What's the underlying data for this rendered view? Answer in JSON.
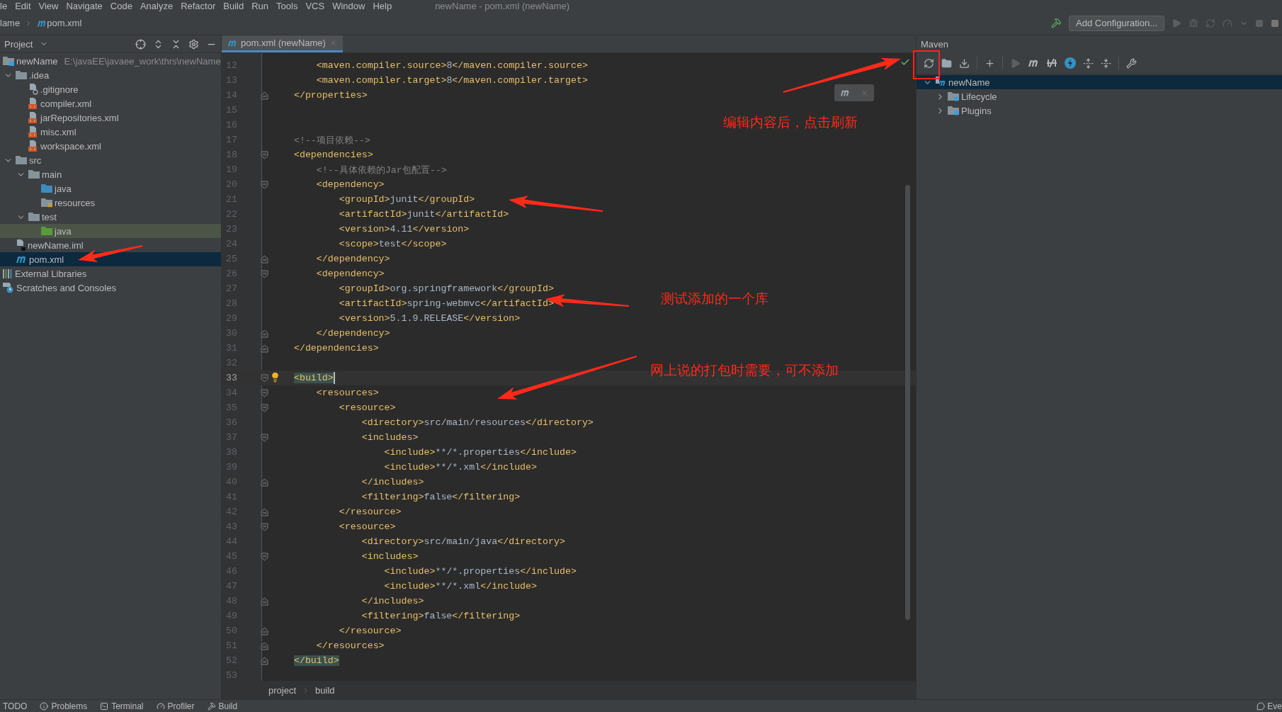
{
  "menu_bar": {
    "items": [
      "le",
      "Edit",
      "View",
      "Navigate",
      "Code",
      "Analyze",
      "Refactor",
      "Build",
      "Run",
      "Tools",
      "VCS",
      "Window",
      "Help"
    ],
    "title": "newName - pom.xml (newName)"
  },
  "nav_bar": {
    "breadcrumbs": [
      {
        "label": "lame",
        "kind": "plain"
      },
      {
        "label": "pom.xml",
        "kind": "maven"
      }
    ],
    "run_config": "Add Configuration..."
  },
  "project_panel": {
    "title": "Project",
    "tree": [
      {
        "label": "newName",
        "kind": "module",
        "path": "E:\\javaEE\\javaee_work\\thrs\\newName",
        "selected": false,
        "children": [
          {
            "label": ".idea",
            "kind": "folder",
            "expanded": true,
            "selected": false,
            "children": [
              {
                "label": ".gitignore",
                "kind": "ignore",
                "selected": false
              },
              {
                "label": "compiler.xml",
                "kind": "xml",
                "selected": false
              },
              {
                "label": "jarRepositories.xml",
                "kind": "xml",
                "selected": false
              },
              {
                "label": "misc.xml",
                "kind": "xml",
                "selected": false
              },
              {
                "label": "workspace.xml",
                "kind": "xml",
                "selected": false
              }
            ]
          },
          {
            "label": "src",
            "kind": "folder",
            "expanded": true,
            "selected": false,
            "children": [
              {
                "label": "main",
                "kind": "folder",
                "expanded": true,
                "selected": false,
                "children": [
                  {
                    "label": "java",
                    "kind": "source",
                    "selected": false
                  },
                  {
                    "label": "resources",
                    "kind": "resources",
                    "selected": false
                  }
                ]
              },
              {
                "label": "test",
                "kind": "folder",
                "expanded": true,
                "selected": false,
                "children": [
                  {
                    "label": "java",
                    "kind": "test",
                    "selected": false,
                    "highlighted": true
                  }
                ]
              }
            ]
          },
          {
            "label": "newName.iml",
            "kind": "iml",
            "selected": false
          },
          {
            "label": "pom.xml",
            "kind": "maven",
            "selected": true
          }
        ]
      },
      {
        "label": "External Libraries",
        "kind": "libraries",
        "selected": false
      },
      {
        "label": "Scratches and Consoles",
        "kind": "scratches",
        "selected": false
      }
    ]
  },
  "editor": {
    "tab": {
      "label": "pom.xml (newName)",
      "selected": true
    },
    "lines": [
      {
        "number": "12",
        "text": "        <maven.compiler.source>8</maven.compiler.source>"
      },
      {
        "number": "13",
        "text": "        <maven.compiler.target>8</maven.compiler.target>"
      },
      {
        "number": "14",
        "text": "    </properties>",
        "kind": "close"
      },
      {
        "number": "15"
      },
      {
        "number": "16"
      },
      {
        "number": "17",
        "text": "    <!--项目依赖-->"
      },
      {
        "number": "18",
        "text": "    <dependencies>",
        "kind": "open"
      },
      {
        "number": "19",
        "text": "        <!--具体依赖的Jar包配置-->"
      },
      {
        "number": "20",
        "text": "        <dependency>",
        "kind": "open"
      },
      {
        "number": "21",
        "text": "            <groupId>junit</groupId>"
      },
      {
        "number": "22",
        "text": "            <artifactId>junit</artifactId>"
      },
      {
        "number": "23",
        "text": "            <version>4.11</version>"
      },
      {
        "number": "24",
        "text": "            <scope>test</scope>"
      },
      {
        "number": "25",
        "text": "        </dependency>",
        "kind": "close"
      },
      {
        "number": "26",
        "text": "        <dependency>",
        "kind": "open"
      },
      {
        "number": "27",
        "text": "            <groupId>org.springframework</groupId>"
      },
      {
        "number": "28",
        "text": "            <artifactId>spring-webmvc</artifactId>"
      },
      {
        "number": "29",
        "text": "            <version>5.1.9.RELEASE</version>"
      },
      {
        "number": "30",
        "text": "        </dependency>",
        "kind": "close"
      },
      {
        "number": "31",
        "text": "    </dependencies>",
        "kind": "close"
      },
      {
        "number": "32"
      },
      {
        "number": "33",
        "text": "    <build>",
        "kind": "open",
        "current": true,
        "matched": true,
        "bulb": true,
        "caret": true
      },
      {
        "number": "34",
        "text": "        <resources>",
        "kind": "open"
      },
      {
        "number": "35",
        "text": "            <resource>",
        "kind": "open"
      },
      {
        "number": "36",
        "text": "                <directory>src/main/resources</directory>"
      },
      {
        "number": "37",
        "text": "                <includes>",
        "kind": "open"
      },
      {
        "number": "38",
        "text": "                    <include>**/*.properties</include>"
      },
      {
        "number": "39",
        "text": "                    <include>**/*.xml</include>"
      },
      {
        "number": "40",
        "text": "                </includes>",
        "kind": "close"
      },
      {
        "number": "41",
        "text": "                <filtering>false</filtering>"
      },
      {
        "number": "42",
        "text": "            </resource>",
        "kind": "close"
      },
      {
        "number": "43",
        "text": "            <resource>",
        "kind": "open"
      },
      {
        "number": "44",
        "text": "                <directory>src/main/java</directory>"
      },
      {
        "number": "45",
        "text": "                <includes>",
        "kind": "open"
      },
      {
        "number": "46",
        "text": "                    <include>**/*.properties</include>"
      },
      {
        "number": "47",
        "text": "                    <include>**/*.xml</include>"
      },
      {
        "number": "48",
        "text": "                </includes>",
        "kind": "close"
      },
      {
        "number": "49",
        "text": "                <filtering>false</filtering>"
      },
      {
        "number": "50",
        "text": "            </resource>",
        "kind": "close"
      },
      {
        "number": "51",
        "text": "        </resources>",
        "kind": "close"
      },
      {
        "number": "52",
        "text": "    </build>",
        "kind": "close",
        "matched": true
      },
      {
        "number": "53"
      }
    ],
    "breadcrumbs": [
      "project",
      "build"
    ]
  },
  "maven_panel": {
    "title": "Maven",
    "tree": [
      {
        "label": "newName",
        "kind": "module",
        "expanded": true,
        "selected": true,
        "children": [
          {
            "label": "Lifecycle",
            "kind": "gear-folder",
            "expanded": false,
            "selected": false
          },
          {
            "label": "Plugins",
            "kind": "gear-folder",
            "expanded": false,
            "selected": false
          }
        ]
      }
    ]
  },
  "status_bar": {
    "items": [
      {
        "label": "TODO",
        "kind": "plain"
      },
      {
        "label": "Problems",
        "kind": "info"
      },
      {
        "label": "Terminal",
        "kind": "terminal"
      },
      {
        "label": "Profiler",
        "kind": "gauge"
      },
      {
        "label": "Build",
        "kind": "hammer"
      }
    ],
    "right": "Eve"
  },
  "annotations": [
    {
      "text": "编辑内容后，点击刷新"
    },
    {
      "text": "测试添加的一个库"
    },
    {
      "text": "网上说的打包时需要，可不添加"
    }
  ]
}
